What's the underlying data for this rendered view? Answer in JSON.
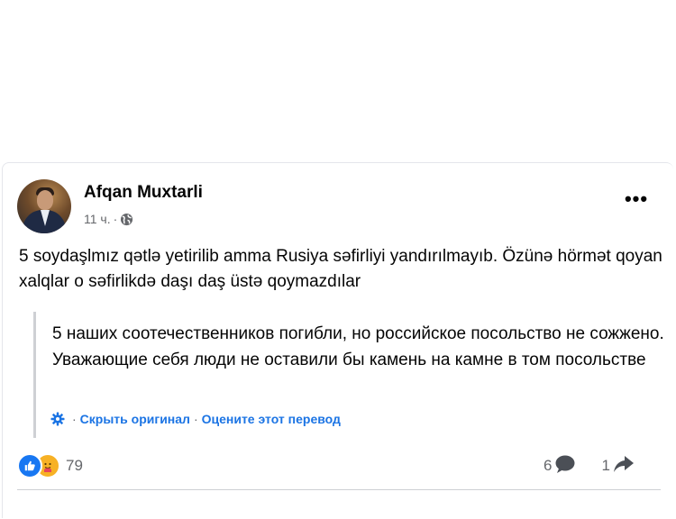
{
  "post": {
    "author": "Afqan Muxtarli",
    "time": "11 ч.",
    "separator": "·",
    "text": "5 soydaşlmız qətlə yetirilib amma Rusiya səfirliyi yandırılmayıb. Özünə hörmət qoyan xalqlar o səfirlikdə daşı daş üstə qoymazdılar",
    "translation": {
      "text": "5 наших соотечественников погибли, но российское посольство не сожжено. Уважающие себя люди не оставили бы камень на камне в том посольстве",
      "hide_original": "Скрыть оригинал",
      "rate": "Оцените этот перевод",
      "sep": "·"
    },
    "reactions": {
      "count": "79",
      "types": [
        "like-icon",
        "care-icon"
      ]
    },
    "comments": "6",
    "shares": "1"
  },
  "colors": {
    "link": "#1b74e4",
    "muted": "#65676b",
    "like": "#1877f2",
    "care": "#f7b125"
  }
}
